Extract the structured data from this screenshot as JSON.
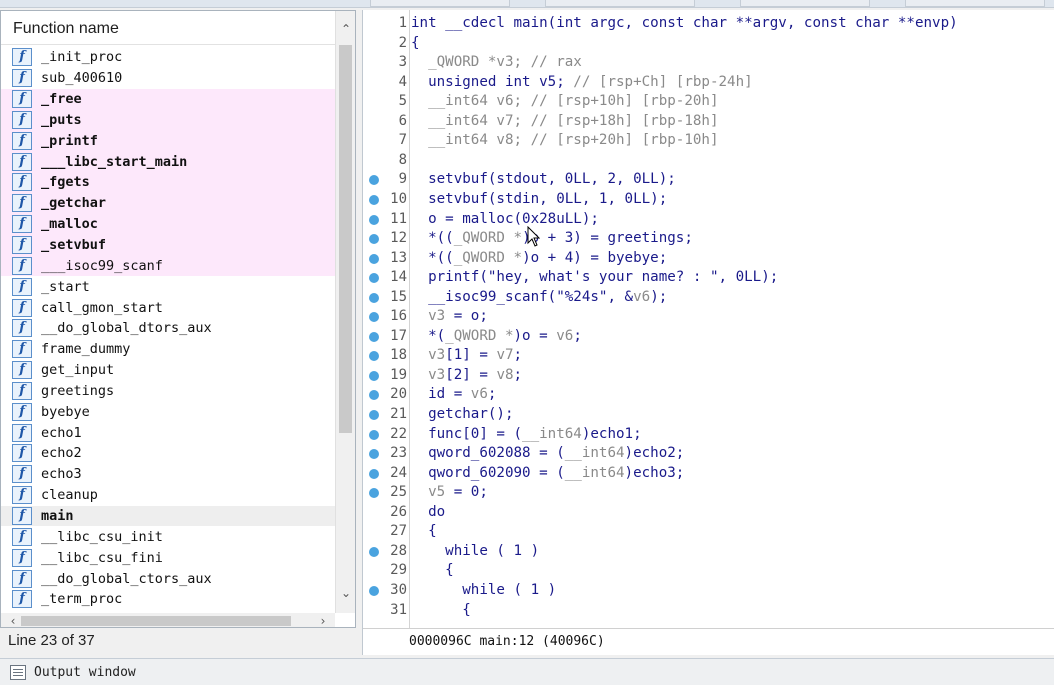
{
  "functions_panel": {
    "header": "Function name",
    "items": [
      {
        "name": "_init_proc",
        "kind": "normal"
      },
      {
        "name": "sub_400610",
        "kind": "normal"
      },
      {
        "name": "_free",
        "kind": "lib"
      },
      {
        "name": "_puts",
        "kind": "lib"
      },
      {
        "name": "_printf",
        "kind": "lib"
      },
      {
        "name": "___libc_start_main",
        "kind": "lib"
      },
      {
        "name": "_fgets",
        "kind": "lib"
      },
      {
        "name": "_getchar",
        "kind": "lib"
      },
      {
        "name": "_malloc",
        "kind": "lib"
      },
      {
        "name": "_setvbuf",
        "kind": "lib"
      },
      {
        "name": "___isoc99_scanf",
        "kind": "lib-plain"
      },
      {
        "name": "_start",
        "kind": "normal"
      },
      {
        "name": "call_gmon_start",
        "kind": "normal"
      },
      {
        "name": "__do_global_dtors_aux",
        "kind": "normal"
      },
      {
        "name": "frame_dummy",
        "kind": "normal"
      },
      {
        "name": "get_input",
        "kind": "normal"
      },
      {
        "name": "greetings",
        "kind": "normal"
      },
      {
        "name": "byebye",
        "kind": "normal"
      },
      {
        "name": "echo1",
        "kind": "normal"
      },
      {
        "name": "echo2",
        "kind": "normal"
      },
      {
        "name": "echo3",
        "kind": "normal"
      },
      {
        "name": "cleanup",
        "kind": "normal"
      },
      {
        "name": "main",
        "kind": "selected"
      },
      {
        "name": "__libc_csu_init",
        "kind": "normal"
      },
      {
        "name": "__libc_csu_fini",
        "kind": "normal"
      },
      {
        "name": "__do_global_ctors_aux",
        "kind": "normal"
      },
      {
        "name": "_term_proc",
        "kind": "normal"
      }
    ],
    "status": "Line 23 of 37",
    "icon_glyph": "f"
  },
  "code_view": {
    "lines": [
      {
        "n": "1",
        "dot": false,
        "parts": [
          [
            "int __cdecl main(int argc, const char **argv, const char **envp)",
            "n"
          ]
        ]
      },
      {
        "n": "2",
        "dot": false,
        "parts": [
          [
            "{",
            "n"
          ]
        ]
      },
      {
        "n": "3",
        "dot": false,
        "parts": [
          [
            "  _QWORD *v3; // rax",
            "g"
          ]
        ]
      },
      {
        "n": "4",
        "dot": false,
        "parts": [
          [
            "  unsigned int v5; ",
            "n"
          ],
          [
            "// [rsp+Ch] [rbp-24h]",
            "g"
          ]
        ]
      },
      {
        "n": "5",
        "dot": false,
        "parts": [
          [
            "  __int64 v6; // [rsp+10h] [rbp-20h]",
            "g"
          ]
        ]
      },
      {
        "n": "6",
        "dot": false,
        "parts": [
          [
            "  __int64 v7; // [rsp+18h] [rbp-18h]",
            "g"
          ]
        ]
      },
      {
        "n": "7",
        "dot": false,
        "parts": [
          [
            "  __int64 v8; // [rsp+20h] [rbp-10h]",
            "g"
          ]
        ]
      },
      {
        "n": "8",
        "dot": false,
        "parts": [
          [
            "",
            "n"
          ]
        ]
      },
      {
        "n": "9",
        "dot": true,
        "parts": [
          [
            "  setvbuf(stdout, 0LL, 2, 0LL);",
            "n"
          ]
        ]
      },
      {
        "n": "10",
        "dot": true,
        "parts": [
          [
            "  setvbuf(stdin, 0LL, 1, 0LL);",
            "n"
          ]
        ]
      },
      {
        "n": "11",
        "dot": true,
        "parts": [
          [
            "  o = malloc(0x28uLL);",
            "n"
          ]
        ]
      },
      {
        "n": "12",
        "dot": true,
        "parts": [
          [
            "  *((",
            "n"
          ],
          [
            "_QWORD *",
            "g"
          ],
          [
            ")o + 3) = greetings;",
            "n"
          ]
        ]
      },
      {
        "n": "13",
        "dot": true,
        "parts": [
          [
            "  *((",
            "n"
          ],
          [
            "_QWORD *",
            "g"
          ],
          [
            ")o + 4) = byebye;",
            "n"
          ]
        ]
      },
      {
        "n": "14",
        "dot": true,
        "parts": [
          [
            "  printf(\"hey, what's your name? : \", 0LL);",
            "n"
          ]
        ]
      },
      {
        "n": "15",
        "dot": true,
        "parts": [
          [
            "  __isoc99_scanf(\"%24s\", &",
            "n"
          ],
          [
            "v6",
            "g"
          ],
          [
            ");",
            "n"
          ]
        ]
      },
      {
        "n": "16",
        "dot": true,
        "parts": [
          [
            "  ",
            "n"
          ],
          [
            "v3",
            "g"
          ],
          [
            " = o;",
            "n"
          ]
        ]
      },
      {
        "n": "17",
        "dot": true,
        "parts": [
          [
            "  *(",
            "n"
          ],
          [
            "_QWORD *",
            "g"
          ],
          [
            ")o = ",
            "n"
          ],
          [
            "v6",
            "g"
          ],
          [
            ";",
            "n"
          ]
        ]
      },
      {
        "n": "18",
        "dot": true,
        "parts": [
          [
            "  ",
            "n"
          ],
          [
            "v3",
            "g"
          ],
          [
            "[1] = ",
            "n"
          ],
          [
            "v7",
            "g"
          ],
          [
            ";",
            "n"
          ]
        ]
      },
      {
        "n": "19",
        "dot": true,
        "parts": [
          [
            "  ",
            "n"
          ],
          [
            "v3",
            "g"
          ],
          [
            "[2] = ",
            "n"
          ],
          [
            "v8",
            "g"
          ],
          [
            ";",
            "n"
          ]
        ]
      },
      {
        "n": "20",
        "dot": true,
        "parts": [
          [
            "  id = ",
            "n"
          ],
          [
            "v6",
            "g"
          ],
          [
            ";",
            "n"
          ]
        ]
      },
      {
        "n": "21",
        "dot": true,
        "parts": [
          [
            "  getchar();",
            "n"
          ]
        ]
      },
      {
        "n": "22",
        "dot": true,
        "parts": [
          [
            "  func[0] = (",
            "n"
          ],
          [
            "__int64",
            "g"
          ],
          [
            ")echo1;",
            "n"
          ]
        ]
      },
      {
        "n": "23",
        "dot": true,
        "parts": [
          [
            "  qword_602088 = (",
            "n"
          ],
          [
            "__int64",
            "g"
          ],
          [
            ")echo2;",
            "n"
          ]
        ]
      },
      {
        "n": "24",
        "dot": true,
        "parts": [
          [
            "  qword_602090 = (",
            "n"
          ],
          [
            "__int64",
            "g"
          ],
          [
            ")echo3;",
            "n"
          ]
        ]
      },
      {
        "n": "25",
        "dot": true,
        "parts": [
          [
            "  ",
            "n"
          ],
          [
            "v5",
            "g"
          ],
          [
            " = 0;",
            "n"
          ]
        ]
      },
      {
        "n": "26",
        "dot": false,
        "parts": [
          [
            "  do",
            "n"
          ]
        ]
      },
      {
        "n": "27",
        "dot": false,
        "parts": [
          [
            "  {",
            "n"
          ]
        ]
      },
      {
        "n": "28",
        "dot": true,
        "parts": [
          [
            "    while ( 1 )",
            "n"
          ]
        ]
      },
      {
        "n": "29",
        "dot": false,
        "parts": [
          [
            "    {",
            "n"
          ]
        ]
      },
      {
        "n": "30",
        "dot": true,
        "parts": [
          [
            "      while ( 1 )",
            "n"
          ]
        ]
      },
      {
        "n": "31",
        "dot": false,
        "parts": [
          [
            "      {",
            "n"
          ]
        ]
      }
    ],
    "address_status": "0000096C main:12 (40096C)"
  },
  "output_window": {
    "label": "Output window"
  },
  "colors": {
    "lib_highlight": "#fde8fb",
    "selected_row": "#eeeeee",
    "breakpoint_dot": "#4aa3df",
    "code_text": "#000080",
    "comment_text": "#8a8a8a"
  }
}
